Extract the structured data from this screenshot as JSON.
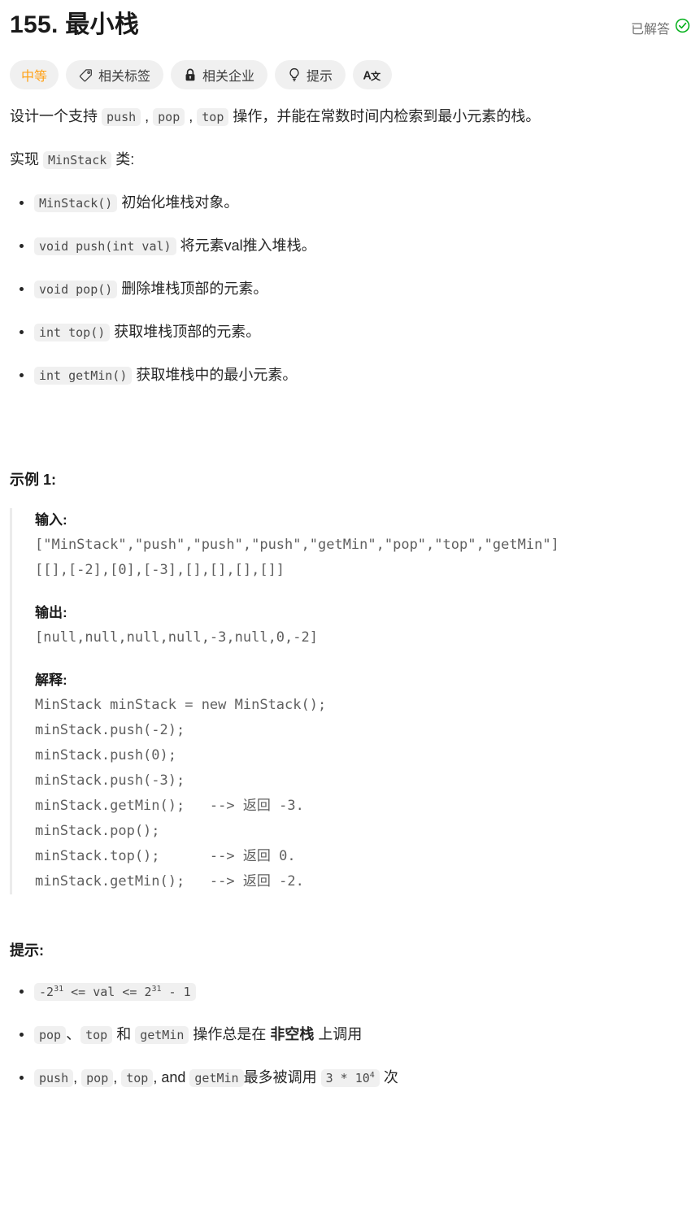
{
  "header": {
    "title": "155. 最小栈",
    "solved_label": "已解答",
    "solved_icon": "check-circle-icon",
    "solved_color": "#00af9b"
  },
  "badges": [
    {
      "label": "中等",
      "icon": null,
      "kind": "difficulty",
      "color": "#ffa116"
    },
    {
      "label": "相关标签",
      "icon": "tag-icon",
      "kind": "normal"
    },
    {
      "label": "相关企业",
      "icon": "lock-icon",
      "kind": "normal"
    },
    {
      "label": "提示",
      "icon": "lightbulb-icon",
      "kind": "normal"
    },
    {
      "label": "",
      "icon": "translate-icon",
      "kind": "icon-only"
    }
  ],
  "description": {
    "line1_part1": "设计一个支持 ",
    "line1_code1": "push",
    "line1_sep1": " , ",
    "line1_code2": "pop",
    "line1_sep2": " , ",
    "line1_code3": "top",
    "line1_part2": " 操作，并能在常数时间内检索到最小元素的栈。",
    "line2_part1": "实现 ",
    "line2_code": "MinStack",
    "line2_part2": " 类:"
  },
  "methods": [
    {
      "code": "MinStack()",
      "text": " 初始化堆栈对象。"
    },
    {
      "code": "void push(int val)",
      "text": " 将元素val推入堆栈。"
    },
    {
      "code": "void pop()",
      "text": " 删除堆栈顶部的元素。"
    },
    {
      "code": "int top()",
      "text": " 获取堆栈顶部的元素。"
    },
    {
      "code": "int getMin()",
      "text": " 获取堆栈中的最小元素。"
    }
  ],
  "example": {
    "heading": "示例 1:",
    "input_label": "输入:",
    "input_value": "[\"MinStack\",\"push\",\"push\",\"push\",\"getMin\",\"pop\",\"top\",\"getMin\"]\n[[],[-2],[0],[-3],[],[],[],[]]",
    "output_label": "输出:",
    "output_value": "[null,null,null,null,-3,null,0,-2]",
    "explain_label": "解释:",
    "explain_value": "MinStack minStack = new MinStack();\nminStack.push(-2);\nminStack.push(0);\nminStack.push(-3);\nminStack.getMin();   --> 返回 -3.\nminStack.pop();\nminStack.top();      --> 返回 0.\nminStack.getMin();   --> 返回 -2."
  },
  "constraints": {
    "heading": "提示:",
    "items": [
      {
        "segments": [
          {
            "type": "code_sup",
            "before": "-2",
            "sup": "31",
            "middle": " <= val <= 2",
            "sup2": "31",
            "after": " - 1"
          }
        ]
      },
      {
        "segments": [
          {
            "type": "code",
            "text": "pop"
          },
          {
            "type": "text",
            "text": "、"
          },
          {
            "type": "code",
            "text": "top"
          },
          {
            "type": "text",
            "text": " 和 "
          },
          {
            "type": "code",
            "text": "getMin"
          },
          {
            "type": "text",
            "text": " 操作总是在 "
          },
          {
            "type": "bold",
            "text": "非空栈"
          },
          {
            "type": "text",
            "text": " 上调用"
          }
        ]
      },
      {
        "segments": [
          {
            "type": "code",
            "text": "push"
          },
          {
            "type": "text",
            "text": ", "
          },
          {
            "type": "code",
            "text": "pop"
          },
          {
            "type": "text",
            "text": ", "
          },
          {
            "type": "code",
            "text": "top"
          },
          {
            "type": "text",
            "text": ", and "
          },
          {
            "type": "code",
            "text": "getMin"
          },
          {
            "type": "text",
            "text": "最多被调用 "
          },
          {
            "type": "code_sup2",
            "before": "3 * 10",
            "sup": "4"
          },
          {
            "type": "text",
            "text": " 次"
          }
        ]
      }
    ]
  }
}
